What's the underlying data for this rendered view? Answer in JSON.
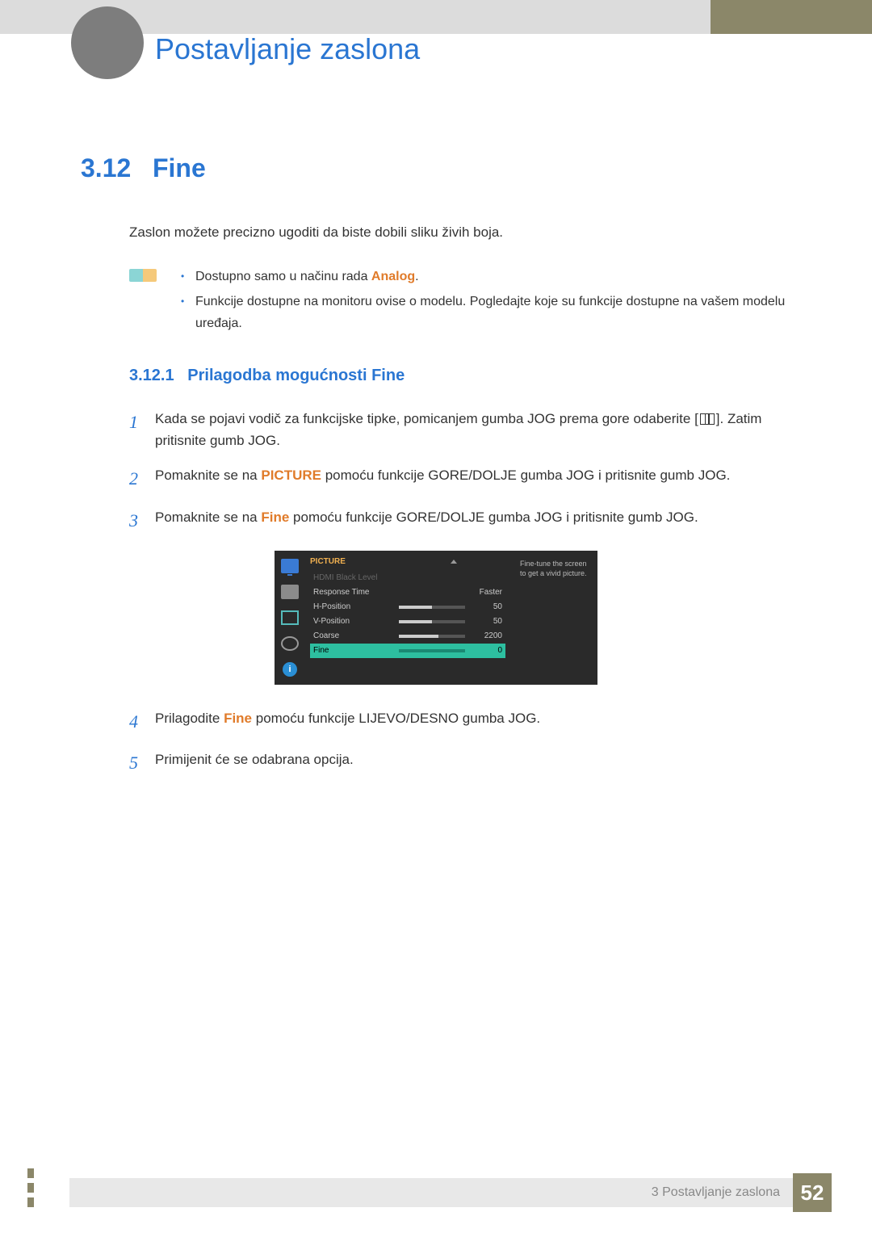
{
  "chapter_title": "Postavljanje zaslona",
  "section": {
    "number": "3.12",
    "title": "Fine"
  },
  "intro": "Zaslon možete precizno ugoditi da biste dobili sliku živih boja.",
  "notes": {
    "item1_pre": "Dostupno samo u načinu rada ",
    "item1_em": "Analog",
    "item1_post": ".",
    "item2": "Funkcije dostupne na monitoru ovise o modelu. Pogledajte koje su funkcije dostupne na vašem modelu uređaja."
  },
  "subsection": {
    "number": "3.12.1",
    "title": "Prilagodba mogućnosti Fine"
  },
  "steps": {
    "s1a": "Kada se pojavi vodič za funkcijske tipke, pomicanjem gumba JOG prema gore odaberite [",
    "s1b": "]. Zatim pritisnite gumb JOG.",
    "s2_pre": "Pomaknite se na ",
    "s2_em": "PICTURE",
    "s2_post": " pomoću funkcije GORE/DOLJE gumba JOG i pritisnite gumb JOG.",
    "s3_pre": "Pomaknite se na ",
    "s3_em": "Fine",
    "s3_post": " pomoću funkcije GORE/DOLJE gumba JOG i pritisnite gumb JOG.",
    "s4_pre": "Prilagodite ",
    "s4_em": "Fine",
    "s4_post": " pomoću funkcije LIJEVO/DESNO gumba JOG.",
    "s5": "Primijenit će se odabrana opcija."
  },
  "osd": {
    "title": "PICTURE",
    "tip": "Fine-tune the screen to get a vivid picture.",
    "rows": {
      "hdmi": {
        "label": "HDMI Black Level",
        "value": ""
      },
      "response": {
        "label": "Response Time",
        "value": "Faster"
      },
      "hpos": {
        "label": "H-Position",
        "value": "50",
        "pct": 50
      },
      "vpos": {
        "label": "V-Position",
        "value": "50",
        "pct": 50
      },
      "coarse": {
        "label": "Coarse",
        "value": "2200",
        "pct": 60
      },
      "fine": {
        "label": "Fine",
        "value": "0",
        "pct": 0
      }
    },
    "info_glyph": "i"
  },
  "footer": {
    "chapter_label": "3 Postavljanje zaslona",
    "page": "52"
  },
  "nums": {
    "n1": "1",
    "n2": "2",
    "n3": "3",
    "n4": "4",
    "n5": "5"
  }
}
